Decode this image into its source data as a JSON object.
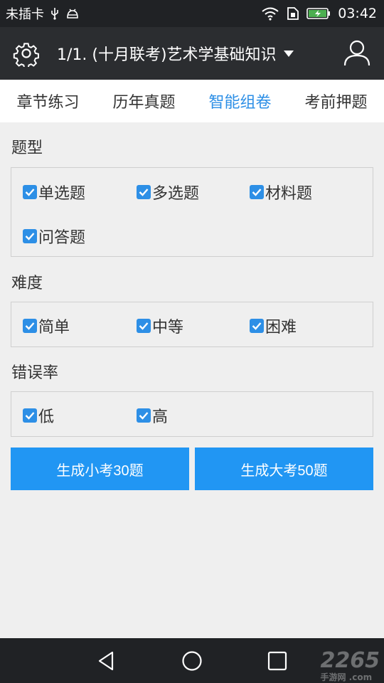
{
  "status_bar": {
    "carrier": "未插卡",
    "time": "03:42"
  },
  "header": {
    "title": "1/1. (十月联考)艺术学基础知识"
  },
  "tabs": [
    {
      "label": "章节练习",
      "active": false
    },
    {
      "label": "历年真题",
      "active": false
    },
    {
      "label": "智能组卷",
      "active": true
    },
    {
      "label": "考前押题",
      "active": false
    }
  ],
  "sections": {
    "type": {
      "label": "题型",
      "options": [
        {
          "label": "单选题",
          "checked": true
        },
        {
          "label": "多选题",
          "checked": true
        },
        {
          "label": "材料题",
          "checked": true
        },
        {
          "label": "问答题",
          "checked": true
        }
      ]
    },
    "difficulty": {
      "label": "难度",
      "options": [
        {
          "label": "简单",
          "checked": true
        },
        {
          "label": "中等",
          "checked": true
        },
        {
          "label": "困难",
          "checked": true
        }
      ]
    },
    "error_rate": {
      "label": "错误率",
      "options": [
        {
          "label": "低",
          "checked": true
        },
        {
          "label": "高",
          "checked": true
        }
      ]
    }
  },
  "actions": {
    "small_exam": "生成小考30题",
    "big_exam": "生成大考50题"
  },
  "watermark": {
    "text": "2265",
    "sub": "手游网 .com"
  },
  "colors": {
    "accent": "#2d8fe6",
    "button": "#2196f3",
    "header_bg": "#2b2d30"
  }
}
